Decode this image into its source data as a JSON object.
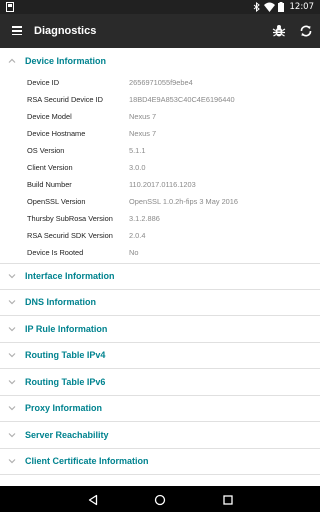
{
  "status_bar": {
    "time": "12:07",
    "icons": [
      "notification-icon",
      "bluetooth-icon",
      "wifi-icon",
      "battery-icon"
    ]
  },
  "app_bar": {
    "title": "Diagnostics",
    "icons": [
      "menu-icon",
      "bug-icon",
      "refresh-icon"
    ]
  },
  "device_info": {
    "title": "Device Information",
    "expanded": true,
    "rows": [
      {
        "key": "Device ID",
        "value": "2656971055f9ebe4"
      },
      {
        "key": "RSA Securid Device ID",
        "value": "18BD4E9A853C40C4E6196440"
      },
      {
        "key": "Device Model",
        "value": "Nexus 7"
      },
      {
        "key": "Device Hostname",
        "value": "Nexus 7"
      },
      {
        "key": "OS Version",
        "value": "5.1.1"
      },
      {
        "key": "Client Version",
        "value": "3.0.0"
      },
      {
        "key": "Build Number",
        "value": "110.2017.0116.1203"
      },
      {
        "key": "OpenSSL Version",
        "value": "OpenSSL 1.0.2h-fips  3 May 2016"
      },
      {
        "key": "Thursby SubRosa Version",
        "value": "3.1.2.886"
      },
      {
        "key": "RSA Securid SDK Version",
        "value": "2.0.4"
      },
      {
        "key": "Device Is Rooted",
        "value": "No"
      }
    ]
  },
  "sections": [
    {
      "title": "Interface Information"
    },
    {
      "title": "DNS Information"
    },
    {
      "title": "IP Rule Information"
    },
    {
      "title": "Routing Table IPv4"
    },
    {
      "title": "Routing Table IPv6"
    },
    {
      "title": "Proxy Information"
    },
    {
      "title": "Server Reachability"
    },
    {
      "title": "Client Certificate Information"
    }
  ],
  "nav_bar": {
    "icons": [
      "back-icon",
      "home-icon",
      "recents-icon"
    ]
  },
  "colors": {
    "accent": "#00838f",
    "app_bar": "#2a2a2a",
    "status_bar": "#212121",
    "value_text": "#8a8a8a"
  }
}
